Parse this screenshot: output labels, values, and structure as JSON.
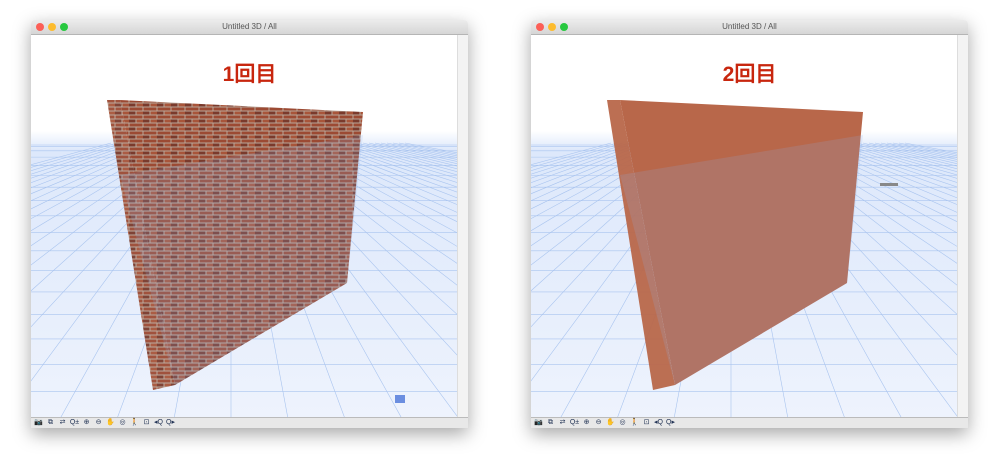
{
  "windows": [
    {
      "title": "Untitled 3D / All",
      "label": "1回目",
      "material": "brick"
    },
    {
      "title": "Untitled 3D / All",
      "label": "2回目",
      "material": "plain"
    }
  ],
  "toolbar": {
    "icons": [
      "camera-icon",
      "zoom-window-icon",
      "explore-icon",
      "zoom-icon",
      "zoom-in-icon",
      "zoom-out-icon",
      "pan-icon",
      "orbit-icon",
      "walk-icon",
      "fit-icon",
      "previous-zoom-icon",
      "next-zoom-icon"
    ],
    "glyphs": [
      "📷",
      "⧉",
      "⇄",
      "Q±",
      "⊕",
      "⊖",
      "✋",
      "◎",
      "🚶",
      "⊡",
      "◂Q",
      "Q▸"
    ]
  },
  "colors": {
    "label": "#c8260e",
    "brick": "#9c4a33",
    "plain": "#b8674a",
    "grid": "#a9c4ef"
  }
}
